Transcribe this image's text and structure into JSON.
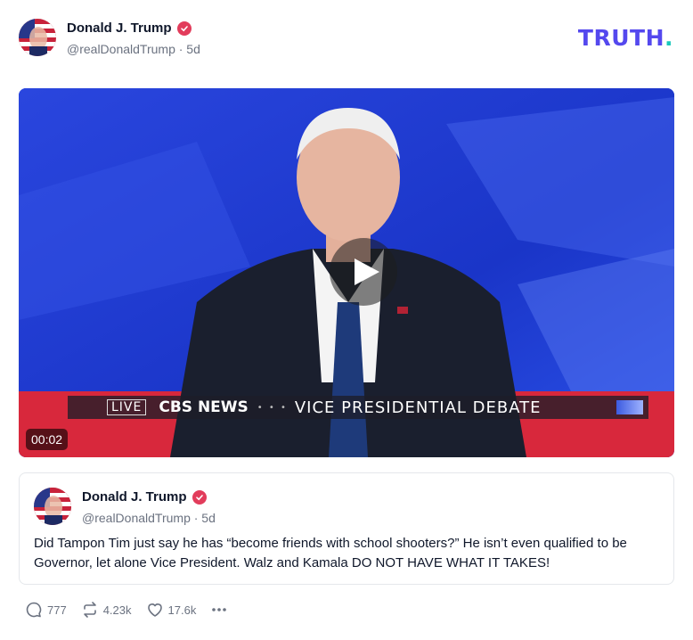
{
  "post": {
    "author_name": "Donald J. Trump",
    "handle_time": "@realDonaldTrump · 5d",
    "avatar_icon": "avatar-flag-portrait"
  },
  "brand": {
    "logo_text": "TRUTH",
    "logo_dot": ".",
    "colors": {
      "primary": "#5448ee",
      "accent": "#19c8bb",
      "verified": "#e23c5b"
    }
  },
  "video": {
    "duration": "00:02",
    "chyron": {
      "live": "LIVE",
      "network": "CBS NEWS",
      "dots": "• • •",
      "title": "VICE PRESIDENTIAL DEBATE"
    },
    "play_icon": "play-icon"
  },
  "quote": {
    "author_name": "Donald J. Trump",
    "handle_time": "@realDonaldTrump · 5d",
    "text": "Did Tampon Tim just say he has “become friends with school shooters?” He isn’t even qualified to be Governor, let alone Vice President. Walz and Kamala DO NOT HAVE WHAT IT TAKES!"
  },
  "actions": {
    "replies": "777",
    "retruths": "4.23k",
    "likes": "17.6k"
  }
}
